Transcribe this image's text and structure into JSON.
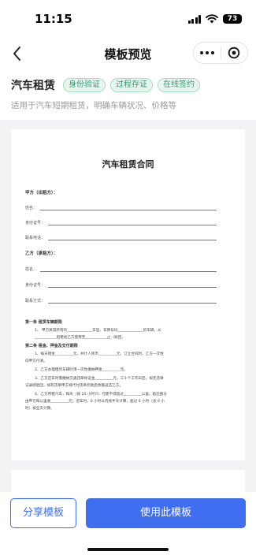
{
  "status_bar": {
    "time": "11:15",
    "battery": "73"
  },
  "nav": {
    "title": "模板预览"
  },
  "template": {
    "name": "汽车租赁",
    "tags": [
      "身份验证",
      "过程存证",
      "在线签约"
    ],
    "description": "适用于汽车短期租赁，明确车辆状况、价格等"
  },
  "document": {
    "title": "汽车租赁合同",
    "party_a": {
      "heading": "甲方（出租方）：",
      "fields": [
        "姓名：",
        "身份证号：",
        "联系电话："
      ]
    },
    "party_b": {
      "heading": "乙方（承租方）：",
      "fields": [
        "姓名：",
        "身份证号：",
        "联系方式："
      ]
    },
    "section1": {
      "heading": "第一条 租赁车辆期限",
      "lines": [
        "1、    甲方将其所有的______________车型、车牌号码______________的车辆，从",
        "____________起租给乙方使用至____________止（收回。"
      ]
    },
    "section2": {
      "heading": "第二条 租金、押金及交付期限",
      "lines": [
        "1、每天租金__________元，共计人民币__________元，订立合同时，乙方一次性",
        "向甲方付清。",
        "2、乙方办理租赁车辆时须一次性缴纳押金__________元。",
        "3、乙方还车时需缴纳交通违章保证金__________元，三十个工作日后，如无违章",
        "记录即退回，如有违章甲方将代付违章罚款后余额返还乙方。",
        "4、乙方所租汽车，每天（按 24 小时计）行使不得超过__________公里，超出部分",
        "由甲方每公里收__________元；迟车时，6 小时以内按半天计算，超过 6 小时（含 6 小",
        "时）按全天计算。"
      ]
    }
  },
  "actions": {
    "share_label": "分享模板",
    "use_label": "使用此模板"
  }
}
